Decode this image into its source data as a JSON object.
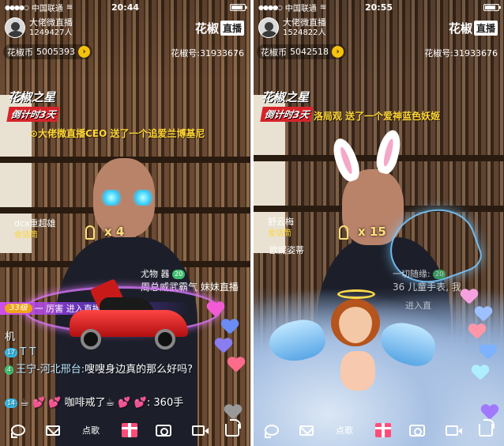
{
  "colors": {
    "gold": "#f5c20b",
    "accent_red": "#d6242a",
    "chat_blue": "#38b5e0",
    "chat_green": "#3fbf6f"
  },
  "left": {
    "status": {
      "carrier": "中国联通",
      "time": "20:44",
      "battery_level": 0.85
    },
    "host": {
      "name": "大佬微直播",
      "viewers": "1249427人"
    },
    "brand": {
      "name": "花椒",
      "box": "直播"
    },
    "coins": {
      "label": "花椒币",
      "value": "5005393",
      "go_icon": "chevron-right"
    },
    "huajiao_id": "花椒号:31933676",
    "event": {
      "title": "花椒之星",
      "subtitle": "倒计时3天"
    },
    "gift_broadcast": "大佬微直播CEO 送了一个追爱兰博基尼",
    "combo": "x 4",
    "viewer_card": {
      "name": "dcx重超雄",
      "badge": "金话筒"
    },
    "gift_notice": {
      "line1": "尤物 器",
      "level": "20",
      "line2": "周总威武霸气 妹妹直播"
    },
    "neon_bar": {
      "level": "33级",
      "text": "一 厉害 进入直播间"
    },
    "chat": [
      {
        "prefix": "机",
        "level": "",
        "user": "",
        "text": ""
      },
      {
        "prefix": "",
        "level": "17",
        "user": "T T",
        "text": ""
      },
      {
        "prefix": "",
        "level": "4",
        "user": "王宁-河北邢台:",
        "text": "嗖嗖身边真的那么好吗?"
      },
      {
        "prefix": "",
        "level": "14",
        "user": "",
        "text": "☕ 💕 💕 咖啡戒了☕ 💕 💕: 360手"
      }
    ],
    "toolbar": {
      "song": "点歌"
    }
  },
  "right": {
    "status": {
      "carrier": "中国联通",
      "time": "20:55",
      "battery_level": 0.8
    },
    "host": {
      "name": "大佬微直播",
      "viewers": "1524822人"
    },
    "brand": {
      "name": "花椒",
      "box": "直播"
    },
    "coins": {
      "label": "花椒币",
      "value": "5042518",
      "go_icon": "chevron-right"
    },
    "huajiao_id": "花椒号:31933676",
    "event": {
      "title": "花椒之星",
      "subtitle": "倒计时3天"
    },
    "gift_broadcast": "洛局观 送了一个爱神蓝色妖姬",
    "combo": "x 15",
    "viewer_card": {
      "name": "舒云梅",
      "badge": "金话筒"
    },
    "gift_notice": {
      "line1": "欧妮姿蒂",
      "level": "",
      "line2": ""
    },
    "side_chat": {
      "line1": "一切随缘:",
      "level": "20",
      "line2": "36 儿童手表, 我"
    },
    "neon_bar": {
      "text": "进入直"
    },
    "toolbar": {
      "song": "点歌"
    }
  }
}
